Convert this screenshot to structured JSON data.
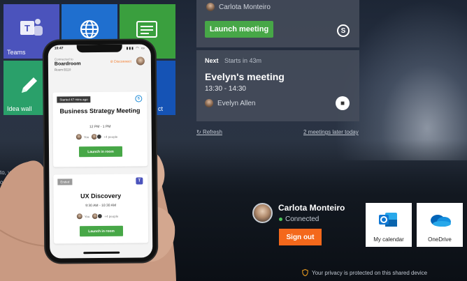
{
  "tiles": [
    {
      "label": "Teams"
    },
    {
      "label": ""
    },
    {
      "label": ""
    },
    {
      "label": "Idea wall"
    },
    {
      "label": "ct"
    }
  ],
  "current_meeting": {
    "organizer": "Carlota Monteiro",
    "launch_label": "Launch meeting",
    "service_icon": "skype-icon"
  },
  "next_meeting": {
    "next_label": "Next",
    "starts_in": "Starts in 43m",
    "title": "Evelyn's meeting",
    "time": "13:30 - 14:30",
    "host": "Evelyn Allen",
    "service_icon": "video-icon"
  },
  "footer_links": {
    "refresh": "Refresh",
    "later": "2 meetings later today"
  },
  "side_text": [
    "to, your",
    "oored fro"
  ],
  "user": {
    "name": "Carlota Monteiro",
    "status": "Connected",
    "signout_label": "Sign out"
  },
  "apps": [
    {
      "label": "My calendar",
      "icon": "outlook-icon"
    },
    {
      "label": "OneDrive",
      "icon": "onedrive-icon"
    }
  ],
  "privacy_text": "Your privacy is protected on this shared device",
  "phone": {
    "status_time": "10:47",
    "status_icons": "▮▮▮ ◠ ▭",
    "connected_to": "Connected to",
    "room": "Boardroom",
    "room_no": "Room B110",
    "disconnect": "Disconnect",
    "meetings": [
      {
        "badge": "Started 47 mins ago",
        "title": "Business Strategy Meeting",
        "time": "12 PM - 1 PM",
        "people": "You",
        "people_extra": "+4 people",
        "launch_label": "Launch in room",
        "service_icon": "skype-icon"
      },
      {
        "badge": "Ended",
        "title": "UX Discovery",
        "time": "9:30 AM - 10:30 AM",
        "people": "You",
        "people_extra": "+4 people",
        "launch_label": "Launch in room",
        "service_icon": "teams-icon"
      }
    ]
  },
  "colors": {
    "launch_green": "#47a747",
    "signout_orange": "#f4681b",
    "teams_purple": "#4b53bc"
  }
}
